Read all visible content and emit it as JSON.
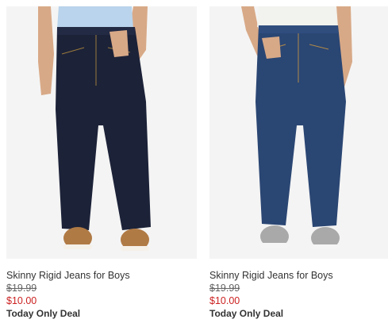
{
  "products": [
    {
      "name": "Skinny Rigid Jeans for Boys",
      "regular_price": "$19.99",
      "sale_price": "$10.00",
      "deal_label": "Today Only Deal",
      "denim_color": "#1c2238",
      "shirt_color": "#b9d4ec",
      "shoe_color": "#b07a45",
      "image_icon": "dark-rinse-jeans-photo"
    },
    {
      "name": "Skinny Rigid Jeans for Boys",
      "regular_price": "$19.99",
      "sale_price": "$10.00",
      "deal_label": "Today Only Deal",
      "denim_color": "#2a4673",
      "shirt_color": "#f2f2ee",
      "shoe_color": "#a9a9a9",
      "image_icon": "medium-wash-jeans-photo"
    }
  ],
  "colors": {
    "sale_price": "#cc2121",
    "text": "#333333",
    "image_background": "#f3f3f3"
  }
}
